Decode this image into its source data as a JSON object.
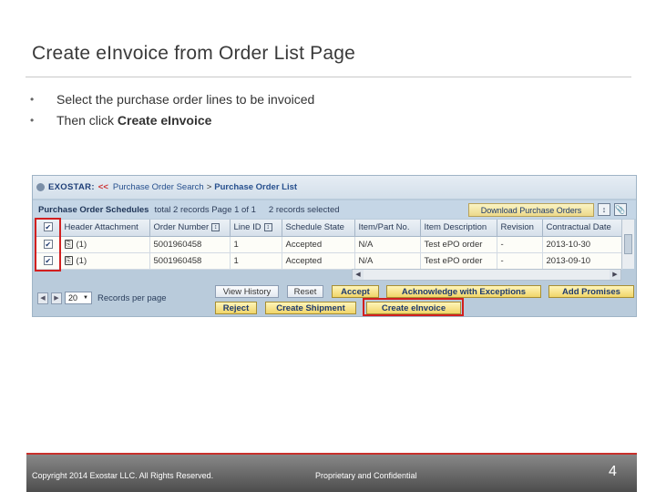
{
  "slide": {
    "title": "Create eInvoice from Order List Page",
    "bullets": {
      "b1": "Select the purchase order lines to be invoiced",
      "b2_prefix": "Then click ",
      "b2_bold": "Create eInvoice"
    }
  },
  "app": {
    "brand": "EXOSTAR:",
    "breadcrumb_arrow": "<<",
    "breadcrumb": {
      "parent": "Purchase Order Search",
      "separator": ">",
      "current": "Purchase Order List"
    },
    "schedules": {
      "heading": "Purchase Order Schedules",
      "info": "total 2 records Page 1 of 1",
      "selected": "2 records selected",
      "download_label": "Download Purchase Orders"
    },
    "columns": [
      "Header Attachment",
      "Order Number",
      "Line ID",
      "Schedule State",
      "Item/Part No.",
      "Item Description",
      "Revision",
      "Contractual Date"
    ],
    "rows": [
      {
        "checked": true,
        "attachment": "(1)",
        "order": "5001960458",
        "line": "1",
        "state": "Accepted",
        "item": "N/A",
        "desc": "Test ePO order",
        "revision": "-",
        "date": "2013-10-30"
      },
      {
        "checked": true,
        "attachment": "(1)",
        "order": "5001960458",
        "line": "1",
        "state": "Accepted",
        "item": "N/A",
        "desc": "Test ePO order",
        "revision": "-",
        "date": "2013-09-10"
      }
    ],
    "pager": {
      "page_size": "20",
      "label": "Records per page"
    },
    "buttons": {
      "view_history": "View History",
      "reset": "Reset",
      "accept": "Accept",
      "ack_exceptions": "Acknowledge with Exceptions",
      "add_promises": "Add Promises",
      "reject": "Reject",
      "create_shipment": "Create Shipment",
      "create_einvoice": "Create eInvoice"
    },
    "icons": {
      "check": "✔",
      "sort": "↕",
      "attach": "📎",
      "left": "◀",
      "right": "▶",
      "dropdown": "▼"
    },
    "highlight_color": "#d21f1f"
  },
  "footer": {
    "copyright": "Copyright 2014 Exostar LLC. All Rights Reserved.",
    "confidential": "Proprietary and Confidential",
    "page": "4"
  }
}
